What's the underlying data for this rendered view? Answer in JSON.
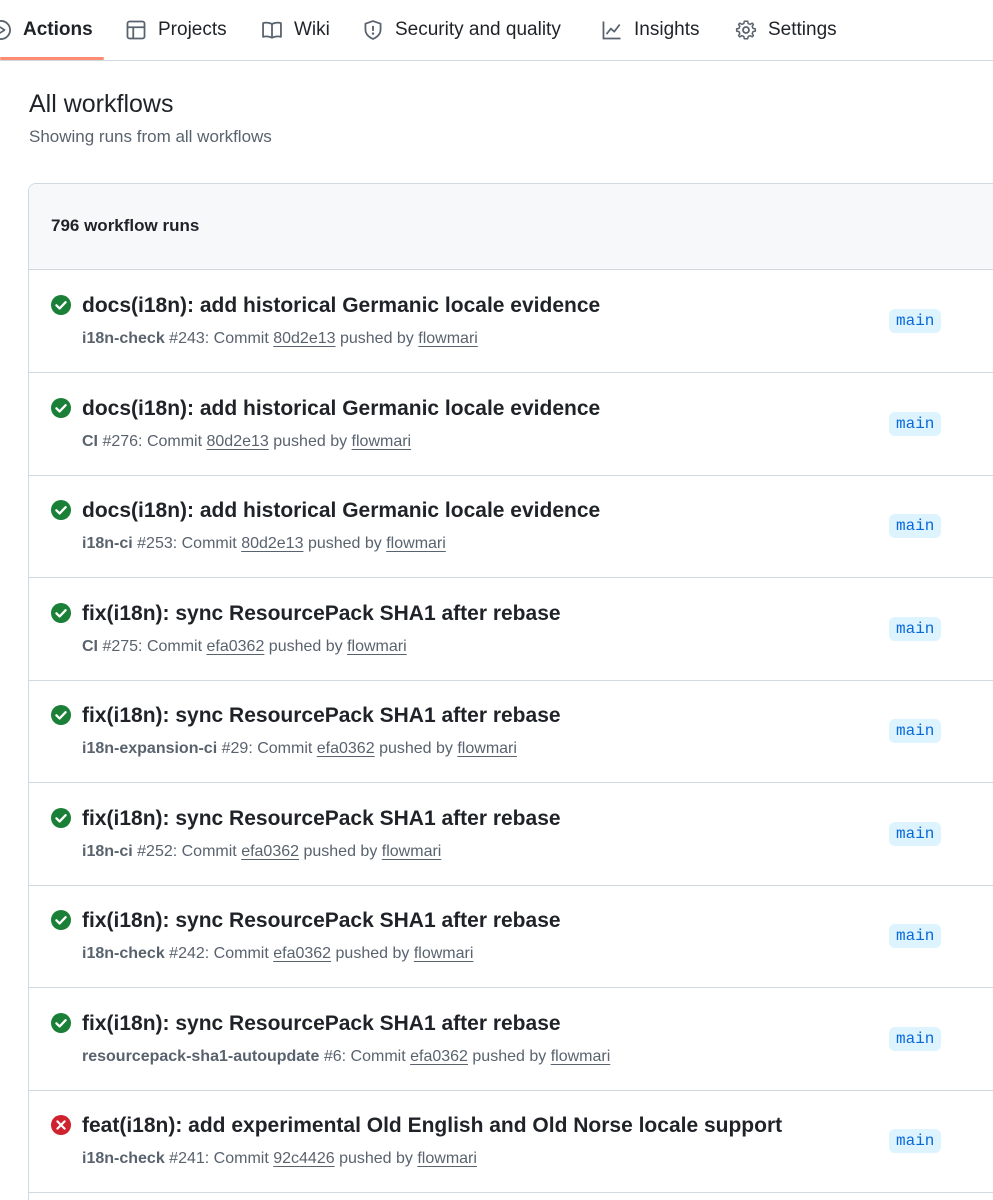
{
  "nav": {
    "tabs": [
      {
        "label": "Actions",
        "icon": "play-icon",
        "selected": true
      },
      {
        "label": "Projects",
        "icon": "table-icon",
        "selected": false
      },
      {
        "label": "Wiki",
        "icon": "book-icon",
        "selected": false
      },
      {
        "label": "Security and quality",
        "icon": "shield-icon",
        "selected": false
      },
      {
        "label": "Insights",
        "icon": "graph-icon",
        "selected": false
      },
      {
        "label": "Settings",
        "icon": "gear-icon",
        "selected": false
      }
    ]
  },
  "page": {
    "title": "All workflows",
    "subtitle": "Showing runs from all workflows"
  },
  "runs": {
    "count_label": "796 workflow runs",
    "items": [
      {
        "title": "docs(i18n): add historical Germanic locale evidence",
        "workflow": "i18n-check",
        "run_number": "#243",
        "commit_label": ": Commit",
        "commit": "80d2e13",
        "pushed_by_label": "pushed by",
        "actor": "flowmari",
        "branch": "main",
        "status": "success"
      },
      {
        "title": "docs(i18n): add historical Germanic locale evidence",
        "workflow": "CI",
        "run_number": "#276",
        "commit_label": ": Commit",
        "commit": "80d2e13",
        "pushed_by_label": "pushed by",
        "actor": "flowmari",
        "branch": "main",
        "status": "success"
      },
      {
        "title": "docs(i18n): add historical Germanic locale evidence",
        "workflow": "i18n-ci",
        "run_number": "#253",
        "commit_label": ": Commit",
        "commit": "80d2e13",
        "pushed_by_label": "pushed by",
        "actor": "flowmari",
        "branch": "main",
        "status": "success"
      },
      {
        "title": "fix(i18n): sync ResourcePack SHA1 after rebase",
        "workflow": "CI",
        "run_number": "#275",
        "commit_label": ": Commit",
        "commit": "efa0362",
        "pushed_by_label": "pushed by",
        "actor": "flowmari",
        "branch": "main",
        "status": "success"
      },
      {
        "title": "fix(i18n): sync ResourcePack SHA1 after rebase",
        "workflow": "i18n-expansion-ci",
        "run_number": "#29",
        "commit_label": ": Commit",
        "commit": "efa0362",
        "pushed_by_label": "pushed by",
        "actor": "flowmari",
        "branch": "main",
        "status": "success"
      },
      {
        "title": "fix(i18n): sync ResourcePack SHA1 after rebase",
        "workflow": "i18n-ci",
        "run_number": "#252",
        "commit_label": ": Commit",
        "commit": "efa0362",
        "pushed_by_label": "pushed by",
        "actor": "flowmari",
        "branch": "main",
        "status": "success"
      },
      {
        "title": "fix(i18n): sync ResourcePack SHA1 after rebase",
        "workflow": "i18n-check",
        "run_number": "#242",
        "commit_label": ": Commit",
        "commit": "efa0362",
        "pushed_by_label": "pushed by",
        "actor": "flowmari",
        "branch": "main",
        "status": "success"
      },
      {
        "title": "fix(i18n): sync ResourcePack SHA1 after rebase",
        "workflow": "resourcepack-sha1-autoupdate",
        "run_number": "#6",
        "commit_label": ": Commit",
        "commit": "efa0362",
        "pushed_by_label": "pushed by",
        "actor": "flowmari",
        "branch": "main",
        "status": "success"
      },
      {
        "title": "feat(i18n): add experimental Old English and Old Norse locale support",
        "workflow": "i18n-check",
        "run_number": "#241",
        "commit_label": ": Commit",
        "commit": "92c4426",
        "pushed_by_label": "pushed by",
        "actor": "flowmari",
        "branch": "main",
        "status": "failure"
      }
    ]
  },
  "colors": {
    "success": "#1a7f37",
    "failure": "#cf222e",
    "accent_underline": "#fd8c73",
    "branch_bg": "#ddf4ff",
    "branch_text": "#0969da"
  }
}
